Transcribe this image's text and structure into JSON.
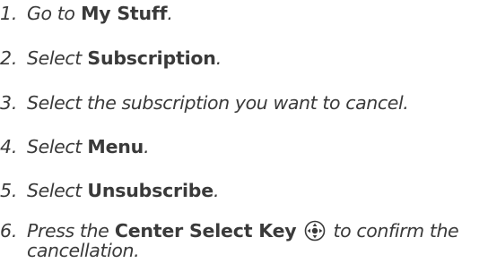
{
  "steps": [
    {
      "number": "1.",
      "verb": "Go to",
      "target": "My Stuff",
      "end": "."
    },
    {
      "number": "2.",
      "verb": "Select",
      "target": "Subscription",
      "end": "."
    },
    {
      "number": "3.",
      "text": "Select the subscription you want to cancel."
    },
    {
      "number": "4.",
      "verb": "Select",
      "target": "Menu",
      "end": "."
    },
    {
      "number": "5.",
      "verb": "Select",
      "target": "Unsubscribe",
      "end": "."
    },
    {
      "number": "6.",
      "verb": "Press the",
      "target": "Center Select Key",
      "after_icon": "to confirm the",
      "line2": "cancellation."
    }
  ],
  "icon": "center-select-key-icon"
}
